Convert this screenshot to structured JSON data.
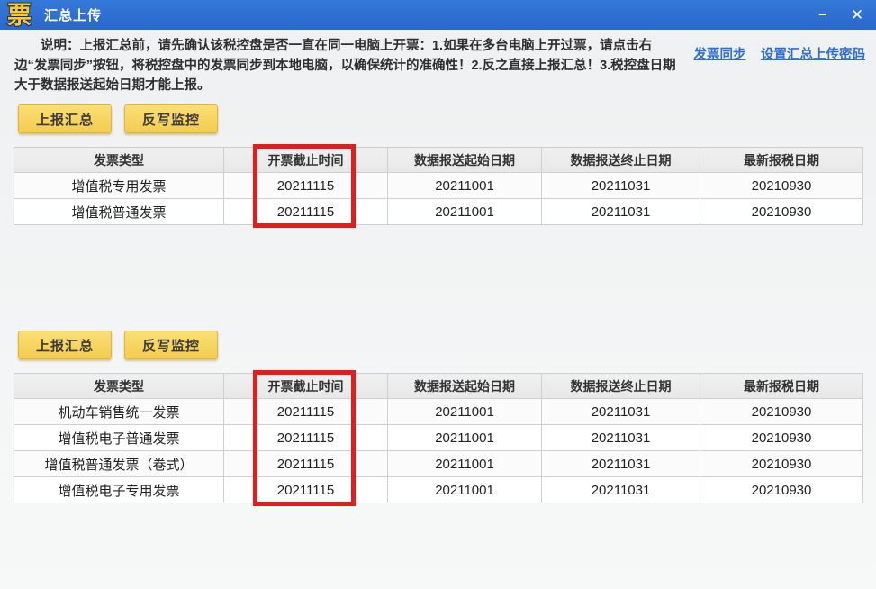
{
  "window": {
    "logo": "票",
    "title": "汇总上传",
    "minimize": "−",
    "close": "✕"
  },
  "notice": {
    "text": "说明：上报汇总前，请先确认该税控盘是否一直在同一电脑上开票：1.如果在多台电脑上开过票，请点击右边“发票同步”按钮，将税控盘中的发票同步到本地电脑，以确保统计的准确性！2.反之直接上报汇总！3.税控盘日期大于数据报送起始日期才能上报。"
  },
  "links": [
    {
      "label": "发票同步"
    },
    {
      "label": "设置汇总上传密码"
    }
  ],
  "buttons": {
    "report": "上报汇总",
    "writeback": "反写监控"
  },
  "tables": [
    {
      "headers": [
        "发票类型",
        "开票截止时间",
        "数据报送起始日期",
        "数据报送终止日期",
        "最新报税日期"
      ],
      "rows": [
        [
          "增值税专用发票",
          "20211115",
          "20211001",
          "20211031",
          "20210930"
        ],
        [
          "增值税普通发票",
          "20211115",
          "20211001",
          "20211031",
          "20210930"
        ]
      ]
    },
    {
      "headers": [
        "发票类型",
        "开票截止时间",
        "数据报送起始日期",
        "数据报送终止日期",
        "最新报税日期"
      ],
      "rows": [
        [
          "机动车销售统一发票",
          "20211115",
          "20211001",
          "20211031",
          "20210930"
        ],
        [
          "增值税电子普通发票",
          "20211115",
          "20211001",
          "20211031",
          "20210930"
        ],
        [
          "增值税普通发票（卷式）",
          "20211115",
          "20211001",
          "20211031",
          "20210930"
        ],
        [
          "增值税电子专用发票",
          "20211115",
          "20211001",
          "20211031",
          "20210930"
        ]
      ]
    }
  ],
  "colors": {
    "titlebar_blue": "#2e6fd2",
    "logo_gold": "#f8c933",
    "button_gold": "#f5d155",
    "link_blue": "#2e6ed0",
    "highlight_red": "#e21d1c",
    "header_gray": "#ebebeb"
  }
}
